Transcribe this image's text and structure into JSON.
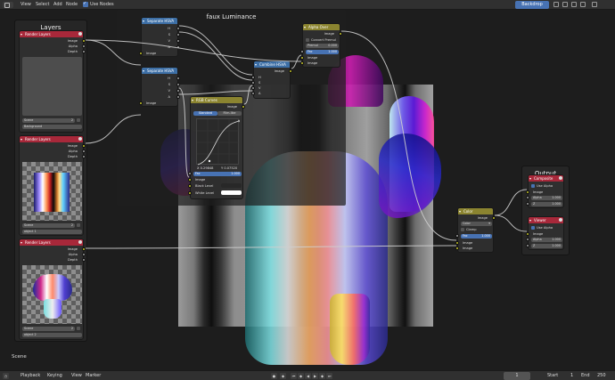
{
  "header": {
    "menus": [
      "View",
      "Select",
      "Add",
      "Node"
    ],
    "use_nodes_label": "Use Nodes",
    "backdrop_label": "Backdrop"
  },
  "frames": {
    "faux_luminance": "faux Luminance",
    "layers": "Layers",
    "output": "Output"
  },
  "nodes": {
    "separate_hsva_1": {
      "title": "Separate HSVA",
      "outputs": [
        "H",
        "S",
        "V",
        "A"
      ],
      "input": "Image"
    },
    "separate_hsva_2": {
      "title": "Separate HSVA",
      "outputs": [
        "H",
        "S",
        "V",
        "A"
      ],
      "input": "Image"
    },
    "combine_hsva": {
      "title": "Combine HSVA",
      "output": "Image",
      "inputs": [
        "H",
        "S",
        "V",
        "A"
      ]
    },
    "alpha_over": {
      "title": "Alpha Over",
      "output": "Image",
      "convert_premul": "Convert Premul",
      "premul_label": "Premul",
      "premul_value": "0.000",
      "fac_label": "Fac",
      "fac_value": "1.000",
      "inputs": [
        "Image",
        "Image"
      ]
    },
    "rgb_curves": {
      "title": "RGB Curves",
      "output": "Image",
      "tab_standard": "Standard",
      "tab_filmlike": "Film-like",
      "x_readout": "X 0.29848",
      "y_readout": "Y 0.07520",
      "fac_label": "Fac",
      "fac_value": "1.000",
      "inputs": [
        "Image",
        "Black Level",
        "White Level"
      ]
    },
    "color_mix": {
      "title": "Color",
      "output": "Image",
      "blend_mode": "Color",
      "clamp": "Clamp",
      "fac_label": "Fac",
      "fac_value": "1.000",
      "inputs": [
        "Image",
        "Image"
      ]
    },
    "composite": {
      "title": "Composite",
      "use_alpha": "Use Alpha",
      "inputs": [
        "Image",
        "Alpha",
        "Z"
      ],
      "alpha_value": "1.000",
      "z_value": "1.000"
    },
    "viewer": {
      "title": "Viewer",
      "use_alpha": "Use Alpha",
      "inputs": [
        "Image",
        "Alpha",
        "Z"
      ],
      "alpha_value": "1.000",
      "z_value": "1.000"
    }
  },
  "render_layers": [
    {
      "title": "Render Layers",
      "outputs": [
        "Image",
        "Alpha",
        "Depth"
      ],
      "scene": "Scene",
      "scene_num": "2",
      "layer": "Background"
    },
    {
      "title": "Render Layers",
      "outputs": [
        "Image",
        "Alpha",
        "Depth"
      ],
      "scene": "Scene",
      "scene_num": "2",
      "layer": "object 1"
    },
    {
      "title": "Render Layers",
      "outputs": [
        "Image",
        "Alpha",
        "Depth"
      ],
      "scene": "Scene",
      "scene_num": "2",
      "layer": "object 2"
    }
  ],
  "scene_label": "Scene",
  "footer": {
    "playback": "Playback",
    "keying": "Keying",
    "view": "View",
    "marker": "Marker",
    "current_frame": "1",
    "start_label": "Start",
    "start_value": "1",
    "end_label": "End",
    "end_value": "250"
  },
  "colors": {
    "accent": "#4772b3",
    "socket_color": "#c7c729",
    "socket_value": "#a1a1a1",
    "socket_vector": "#6363c7",
    "header_input": "#a8283a",
    "header_converter": "#3d6fa6",
    "header_color": "#8b8430"
  }
}
